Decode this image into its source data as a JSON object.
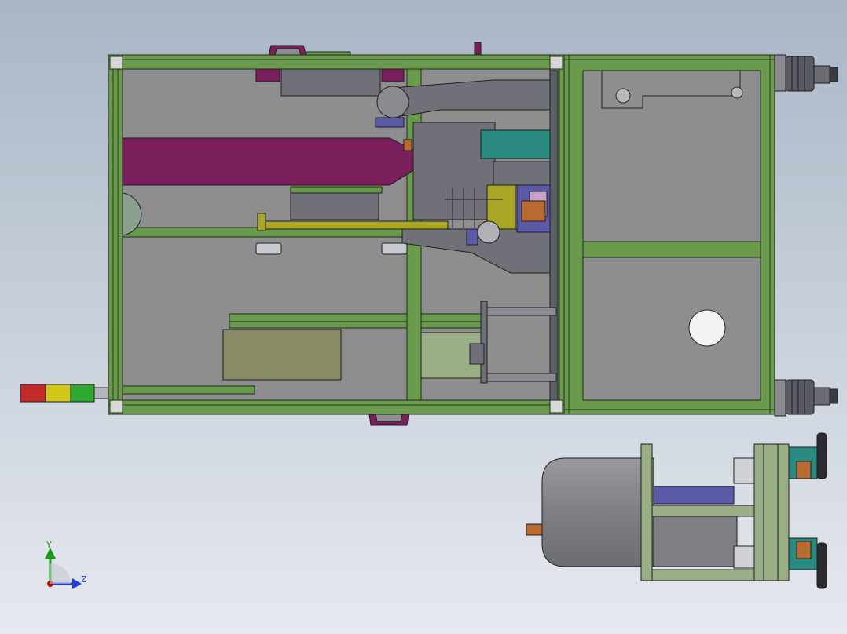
{
  "viewport": {
    "background_top": "#a9b6c6",
    "background_bottom": "#e6e9ef"
  },
  "axes": {
    "y_label": "Y",
    "z_label": "Z",
    "y_color": "#1a9a1a",
    "z_color": "#1f3fd6",
    "origin_color": "#b01515"
  },
  "colors": {
    "frame_green": "#6a9a4c",
    "frame_edge": "#1f2a1a",
    "panel_gray": "#8e8e8e",
    "mech_gray": "#6f7078",
    "magenta": "#7a1f5c",
    "olive": "#a8a624",
    "khaki": "#8a8a66",
    "purple": "#5a5aa8",
    "teal": "#2a8a80",
    "orange": "#b86a30",
    "light_green": "#9aae86",
    "signal_red": "#c42a2a",
    "signal_yellow": "#d2c81c",
    "signal_green": "#2ea82e"
  },
  "components": {
    "main_frame": "main-frame",
    "electrical_cabinet": "electrical-cabinet",
    "side_view": "side-elevation-view",
    "signal_tower": "signal-tower",
    "caster_wheels": [
      "caster-wheel-top",
      "caster-wheel-bottom"
    ]
  }
}
